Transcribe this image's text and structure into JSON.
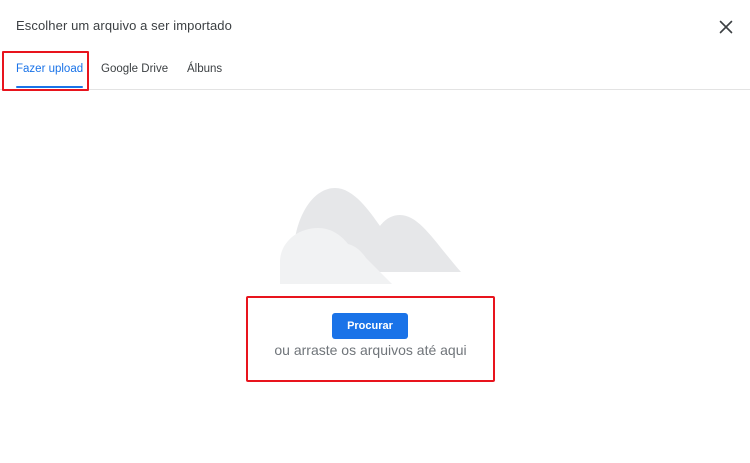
{
  "dialog": {
    "title": "Escolher um arquivo a ser importado",
    "close_icon": "close-icon"
  },
  "tabs": [
    {
      "label": "Fazer upload",
      "active": true
    },
    {
      "label": "Google Drive",
      "active": false
    },
    {
      "label": "Álbuns",
      "active": false
    }
  ],
  "upload": {
    "illustration_icon": "cloud-icon",
    "browse_label": "Procurar",
    "drag_text": "ou arraste os arquivos até aqui"
  },
  "colors": {
    "accent": "#1a73e8",
    "highlight": "#e8141d",
    "cloud": "#e6e7e9"
  }
}
